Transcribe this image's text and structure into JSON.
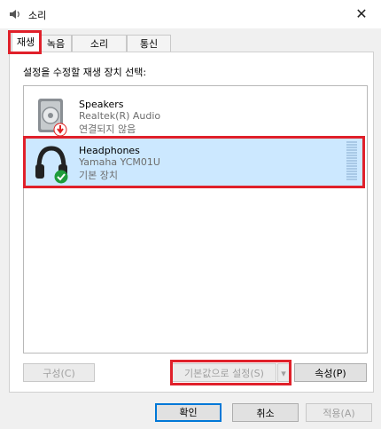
{
  "window": {
    "title": "소리",
    "close_label": "✕"
  },
  "tabs": [
    {
      "label": "재생",
      "active": true
    },
    {
      "label": "녹음",
      "active": false
    },
    {
      "label": "소리",
      "active": false
    },
    {
      "label": "통신",
      "active": false
    }
  ],
  "playback": {
    "instruction": "설정을 수정할 재생 장치 선택:",
    "devices": [
      {
        "name": "Speakers",
        "description": "Realtek(R) Audio",
        "status": "연결되지 않음",
        "icon": "speaker-icon",
        "badge": "disconnected-badge",
        "selected": false
      },
      {
        "name": "Headphones",
        "description": "Yamaha YCM01U",
        "status": "기본 장치",
        "icon": "headphones-icon",
        "badge": "default-check-badge",
        "selected": true
      }
    ],
    "buttons": {
      "configure": "구성(C)",
      "set_default": "기본값으로 설정(S)",
      "dropdown_arrow": "▾",
      "properties": "속성(P)"
    }
  },
  "footer": {
    "ok": "확인",
    "cancel": "취소",
    "apply": "적용(A)"
  },
  "colors": {
    "selection": "#cce8ff",
    "highlight": "#e0202a",
    "accent": "#0078d7",
    "check": "#1e9c3b",
    "disconnected": "#e02020"
  }
}
